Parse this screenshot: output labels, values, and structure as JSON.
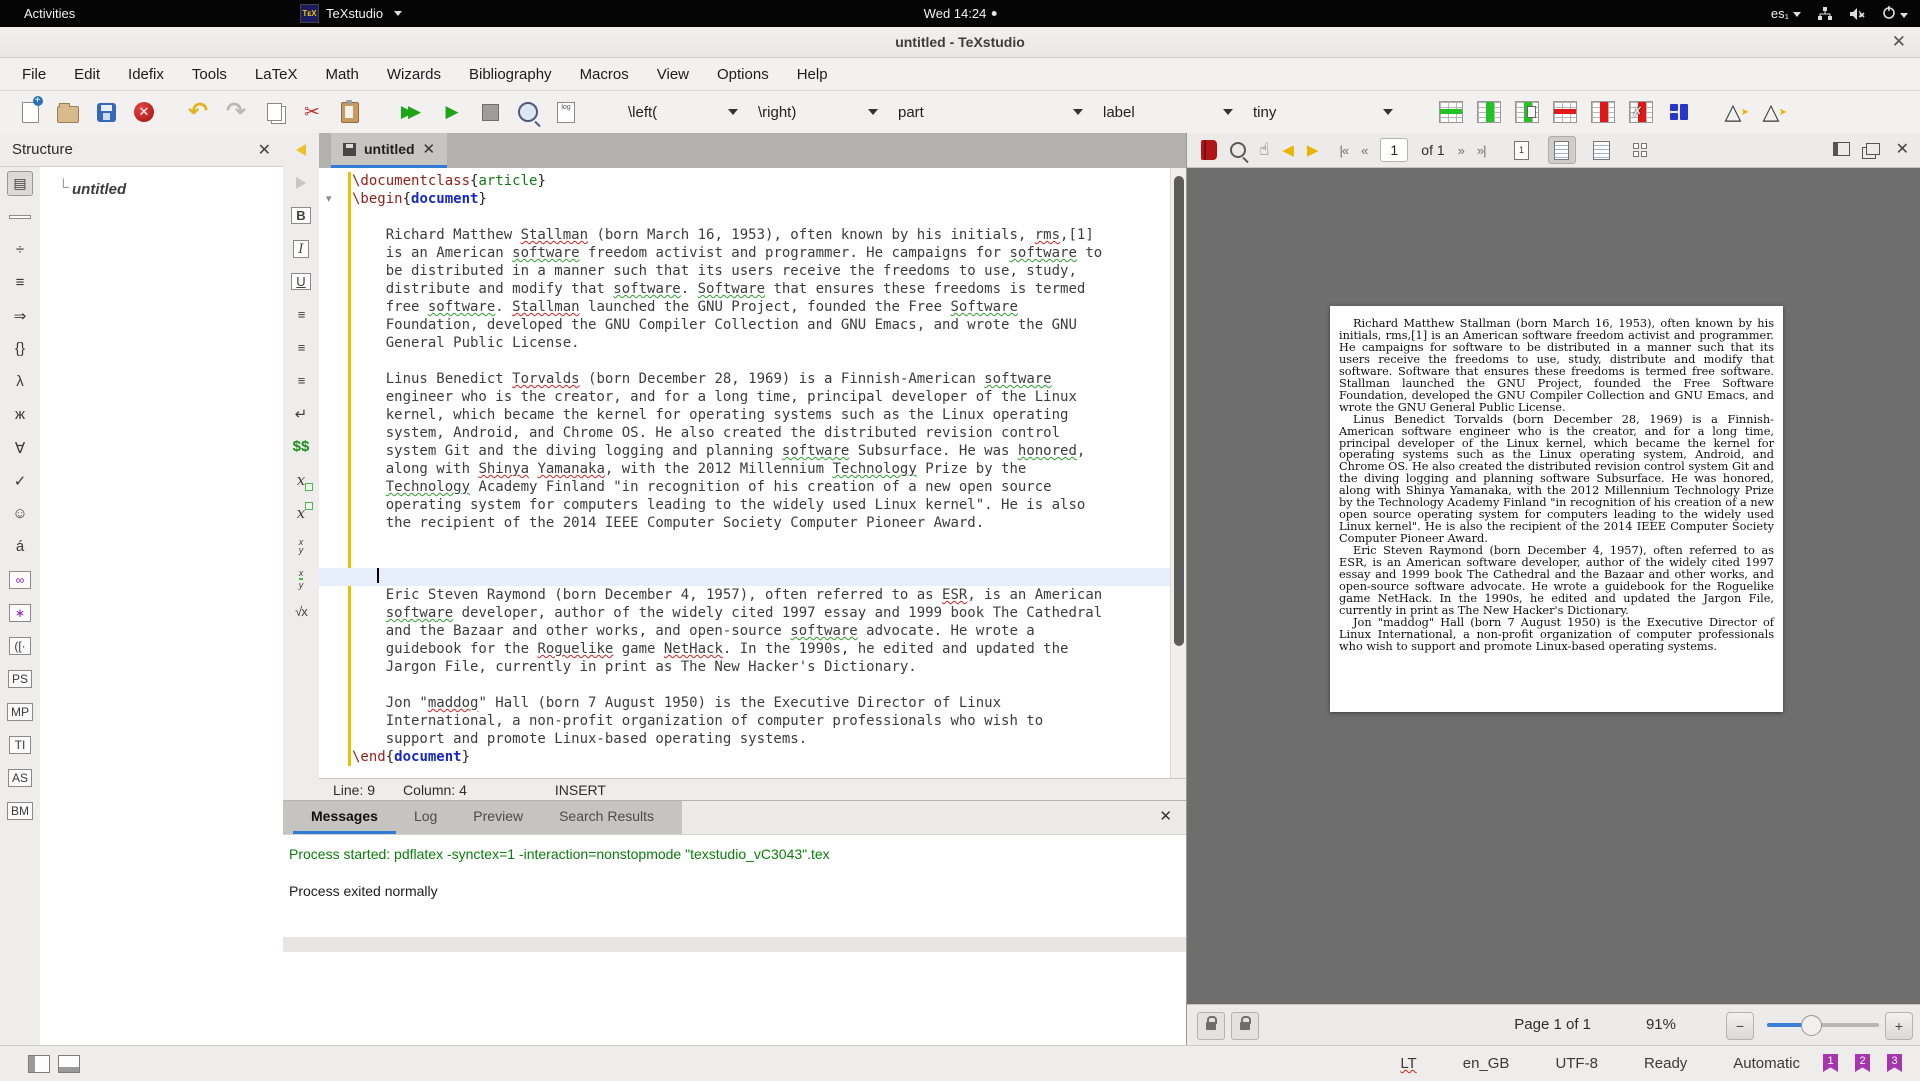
{
  "topbar": {
    "activities": "Activities",
    "app_name": "TeXstudio",
    "clock": "Wed 14:24",
    "keyboard_layout": "es₁"
  },
  "titlebar": {
    "title": "untitled - TeXstudio",
    "close_glyph": "✕"
  },
  "menus": [
    "File",
    "Edit",
    "Idefix",
    "Tools",
    "LaTeX",
    "Math",
    "Wizards",
    "Bibliography",
    "Macros",
    "View",
    "Options",
    "Help"
  ],
  "toolbar": {
    "dropdowns": [
      "\\left(",
      "\\right)",
      "part",
      "label",
      "tiny"
    ]
  },
  "structure": {
    "title": "Structure",
    "close_glyph": "✕",
    "root_item": "untitled"
  },
  "side_icons": [
    {
      "name": "structure-panel",
      "glyph": "▤",
      "boxed": true,
      "selected": true
    },
    {
      "name": "bookmarks-panel",
      "shape": "bmk",
      "boxed": true
    },
    {
      "name": "symbols-operators",
      "glyph": "÷"
    },
    {
      "name": "symbols-relations",
      "glyph": "≡"
    },
    {
      "name": "symbols-arrows",
      "glyph": "⇒"
    },
    {
      "name": "symbols-delimiters",
      "glyph": "{}"
    },
    {
      "name": "symbols-greek",
      "glyph": "λ"
    },
    {
      "name": "symbols-cyrillic",
      "glyph": "ж"
    },
    {
      "name": "symbols-logic",
      "glyph": "∀"
    },
    {
      "name": "symbols-check",
      "glyph": "✓"
    },
    {
      "name": "symbols-misc",
      "glyph": "☺"
    },
    {
      "name": "symbols-accents",
      "glyph": "á"
    },
    {
      "name": "symbols-infinity",
      "glyph": "∞",
      "boxed": true,
      "purple": true
    },
    {
      "name": "symbols-star",
      "glyph": "∗",
      "boxed": true,
      "purple": true
    },
    {
      "name": "left-delimiters",
      "glyph": "([·",
      "boxed": true
    },
    {
      "name": "pstricks-commands",
      "glyph": "PS",
      "boxed": true
    },
    {
      "name": "metapost-commands",
      "glyph": "MP",
      "boxed": true
    },
    {
      "name": "tikz-commands",
      "glyph": "TI",
      "boxed": true
    },
    {
      "name": "asymptote-commands",
      "glyph": "AS",
      "boxed": true
    },
    {
      "name": "beamer-commands",
      "glyph": "BM",
      "boxed": true
    }
  ],
  "mid_icons": [
    {
      "name": "previous-change",
      "shape": "tri-l"
    },
    {
      "name": "next-change",
      "shape": "tri-r"
    },
    {
      "name": "bold",
      "glyph": "B",
      "boxed": true,
      "style": "b"
    },
    {
      "name": "italic",
      "glyph": "I",
      "boxed": true,
      "style": "i"
    },
    {
      "name": "underline",
      "glyph": "U",
      "boxed": true,
      "style": "u"
    },
    {
      "name": "align-left",
      "glyph": "≡",
      "cls": "mean"
    },
    {
      "name": "align-center",
      "glyph": "≡",
      "cls": "mean"
    },
    {
      "name": "align-right",
      "glyph": "≡",
      "cls": "mean"
    },
    {
      "name": "insert-newline",
      "glyph": "↵"
    },
    {
      "name": "inline-math",
      "glyph": "$$",
      "cls": "gmath"
    },
    {
      "name": "subscript",
      "shape": "sub"
    },
    {
      "name": "superscript",
      "shape": "sup"
    },
    {
      "name": "fraction-stacked",
      "shape": "frac1"
    },
    {
      "name": "fraction-slash",
      "shape": "frac2"
    },
    {
      "name": "square-root",
      "glyph": "√x",
      "cls": "mean"
    }
  ],
  "editor": {
    "tab_label": "untitled",
    "tab_close_glyph": "✕",
    "status": {
      "line": "Line: 9",
      "column": "Column: 4",
      "mode": "INSERT"
    },
    "lines": [
      {
        "tokens": [
          {
            "t": "\\documentclass",
            "s": "cmd"
          },
          {
            "t": "{",
            "s": "br"
          },
          {
            "t": "article",
            "s": "grn"
          },
          {
            "t": "}",
            "s": "br"
          }
        ]
      },
      {
        "tokens": [
          {
            "t": "\\begin",
            "s": "cmd"
          },
          {
            "t": "{",
            "s": "br"
          },
          {
            "t": "document",
            "s": "env"
          },
          {
            "t": "}",
            "s": "br"
          }
        ]
      },
      {
        "plain": ""
      },
      {
        "plain": "    Richard Matthew Stallman (born March 16, 1953), often known by his initials, rms,[1]"
      },
      {
        "plain": "    is an American software freedom activist and programmer. He campaigns for software to"
      },
      {
        "plain": "    be distributed in a manner such that its users receive the freedoms to use, study,"
      },
      {
        "plain": "    distribute and modify that software. Software that ensures these freedoms is termed"
      },
      {
        "plain": "    free software. Stallman launched the GNU Project, founded the Free Software"
      },
      {
        "plain": "    Foundation, developed the GNU Compiler Collection and GNU Emacs, and wrote the GNU"
      },
      {
        "plain": "    General Public License."
      },
      {
        "plain": ""
      },
      {
        "plain": "    Linus Benedict Torvalds (born December 28, 1969) is a Finnish-American software"
      },
      {
        "plain": "    engineer who is the creator, and for a long time, principal developer of the Linux"
      },
      {
        "plain": "    kernel, which became the kernel for operating systems such as the Linux operating"
      },
      {
        "plain": "    system, Android, and Chrome OS. He also created the distributed revision control"
      },
      {
        "plain": "    system Git and the diving logging and planning software Subsurface. He was honored,"
      },
      {
        "plain": "    along with Shinya Yamanaka, with the 2012 Millennium Technology Prize by the"
      },
      {
        "plain": "    Technology Academy Finland \"in recognition of his creation of a new open source"
      },
      {
        "plain": "    operating system for computers leading to the widely used Linux kernel\". He is also"
      },
      {
        "plain": "    the recipient of the 2014 IEEE Computer Society Computer Pioneer Award."
      },
      {
        "plain": ""
      },
      {
        "plain": ""
      },
      {
        "plain": "   ",
        "cursor": true
      },
      {
        "plain": "    Eric Steven Raymond (born December 4, 1957), often referred to as ESR, is an American"
      },
      {
        "plain": "    software developer, author of the widely cited 1997 essay and 1999 book The Cathedral"
      },
      {
        "plain": "    and the Bazaar and other works, and open-source software advocate. He wrote a"
      },
      {
        "plain": "    guidebook for the Roguelike game NetHack. In the 1990s, he edited and updated the"
      },
      {
        "plain": "    Jargon File, currently in print as The New Hacker's Dictionary."
      },
      {
        "plain": ""
      },
      {
        "plain": "    Jon \"maddog\" Hall (born 7 August 1950) is the Executive Director of Linux"
      },
      {
        "plain": "    International, a non-profit organization of computer professionals who wish to"
      },
      {
        "plain": "    support and promote Linux-based operating systems."
      },
      {
        "tokens": [
          {
            "t": "\\end",
            "s": "cmd"
          },
          {
            "t": "{",
            "s": "br"
          },
          {
            "t": "document",
            "s": "env"
          },
          {
            "t": "}",
            "s": "br"
          }
        ]
      }
    ]
  },
  "spell": {
    "red": [
      "Stallman",
      "rms",
      "Torvalds",
      "Shinya",
      "Yamanaka",
      "maddog",
      "Roguelike",
      "NetHack",
      "ESR"
    ],
    "green": [
      "software",
      "Software",
      "honored",
      "Technology"
    ]
  },
  "messages": {
    "tabs": [
      "Messages",
      "Log",
      "Preview",
      "Search Results"
    ],
    "active_tab": "Messages",
    "close_glyph": "✕",
    "lines": [
      {
        "text": "Process started: pdflatex -synctex=1 -interaction=nonstopmode \"texstudio_vC3043\".tex",
        "color": "mgreen"
      },
      {
        "text": "Process exited normally",
        "color": "mblack"
      }
    ]
  },
  "pdf": {
    "page_input": "1",
    "of_label": "of 1",
    "page_info": "Page 1 of 1",
    "zoom_level": "91%",
    "paragraphs": [
      "Richard Matthew Stallman (born March 16, 1953), often known by his initials, rms,[1] is an American software freedom activist and programmer. He campaigns for software to be distributed in a manner such that its users receive the freedoms to use, study, distribute and modify that software. Software that ensures these freedoms is termed free software. Stallman launched the GNU Project, founded the Free Software Foundation, developed the GNU Compiler Collection and GNU Emacs, and wrote the GNU General Public License.",
      "Linus Benedict Torvalds (born December 28, 1969) is a Finnish-American software engineer who is the creator, and for a long time, principal developer of the Linux kernel, which became the kernel for operating systems such as the Linux operating system, Android, and Chrome OS. He also created the distributed revision control system Git and the diving logging and planning software Subsurface. He was honored, along with Shinya Yamanaka, with the 2012 Millennium Technology Prize by the Technology Academy Finland \"in recognition of his creation of a new open source operating system for computers leading to the widely used Linux kernel\". He is also the recipient of the 2014 IEEE Computer Society Computer Pioneer Award.",
      "Eric Steven Raymond (born December 4, 1957), often referred to as ESR, is an American software developer, author of the widely cited 1997 essay and 1999 book The Cathedral and the Bazaar and other works, and open-source software advocate. He wrote a guidebook for the Roguelike game NetHack. In the 1990s, he edited and updated the Jargon File, currently in print as The New Hacker's Dictionary.",
      "Jon \"maddog\" Hall (born 7 August 1950) is the Executive Director of Linux International, a non-profit organization of computer professionals who wish to support and promote Linux-based operating systems."
    ]
  },
  "statusbar": {
    "items": [
      "LT",
      "en_GB",
      "UTF-8",
      "Ready",
      "Automatic"
    ],
    "bookmarks": [
      "1",
      "2",
      "3"
    ]
  },
  "colors": {
    "accent_blue": "#2f7cd6",
    "command_red": "#942017",
    "env_blue": "#1626c8",
    "string_green": "#117a11",
    "message_green": "#0b7d0b",
    "bookmark_purple": "#a435aa",
    "pdf_background": "#6e6e6e"
  }
}
